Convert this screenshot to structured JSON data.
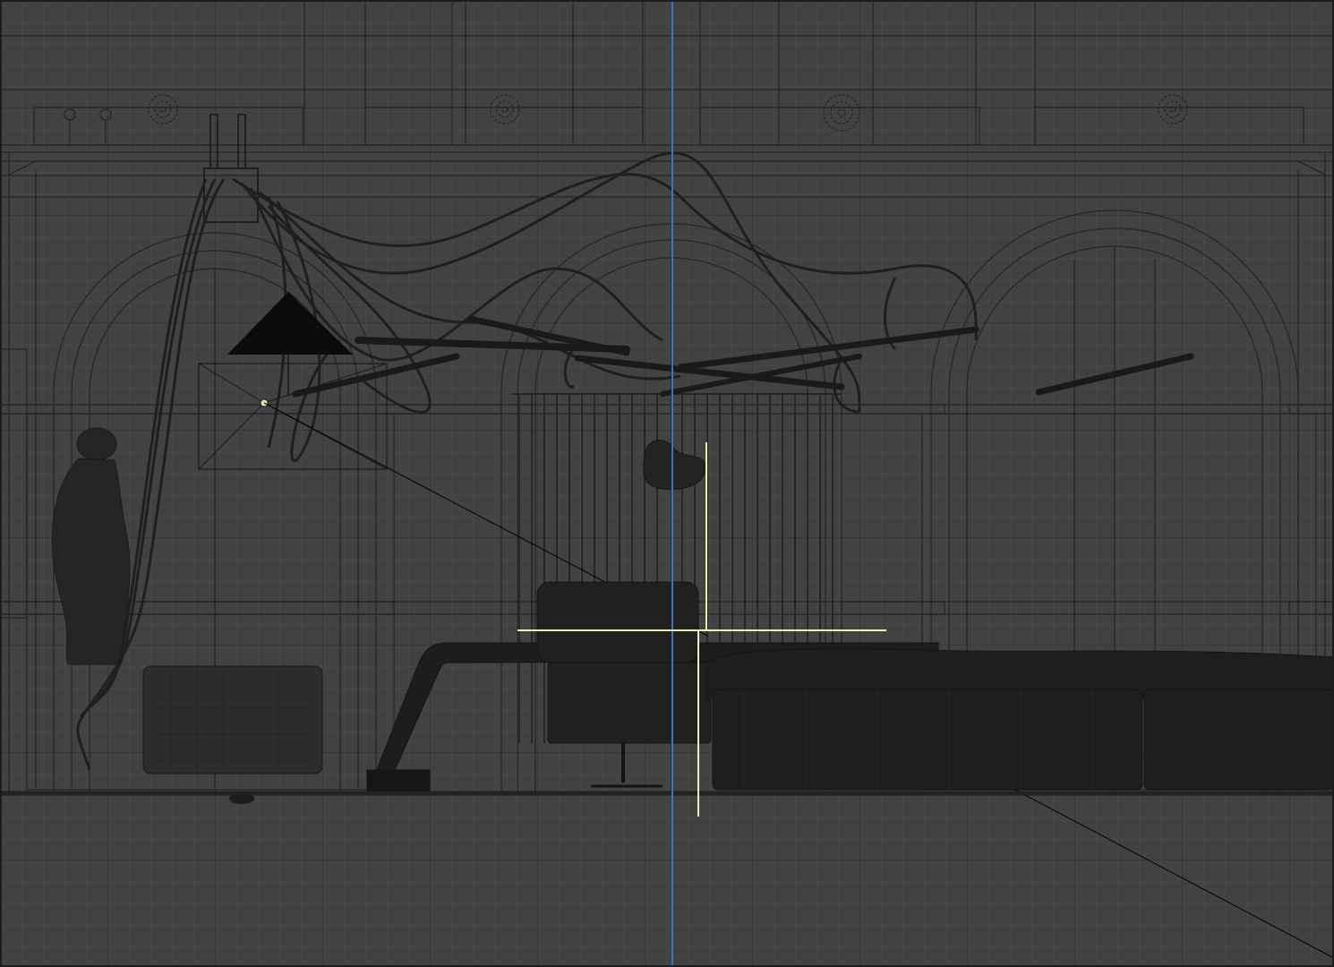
{
  "viewport": {
    "mode": "front-orthographic-wireframe",
    "background_color": "#424242",
    "grid_minor_color": "#4d4d4d",
    "grid_major_color": "#2e2e2e",
    "wire_color": "#262626",
    "solid_color": "#1e1e1e",
    "world_axis_color": "#3f72c4",
    "gizmo_color": "#f3efb0",
    "selection_line_color": "#000000"
  },
  "icons": {
    "gizmo": "move-gizmo-icon",
    "light": "spot-light-icon"
  }
}
